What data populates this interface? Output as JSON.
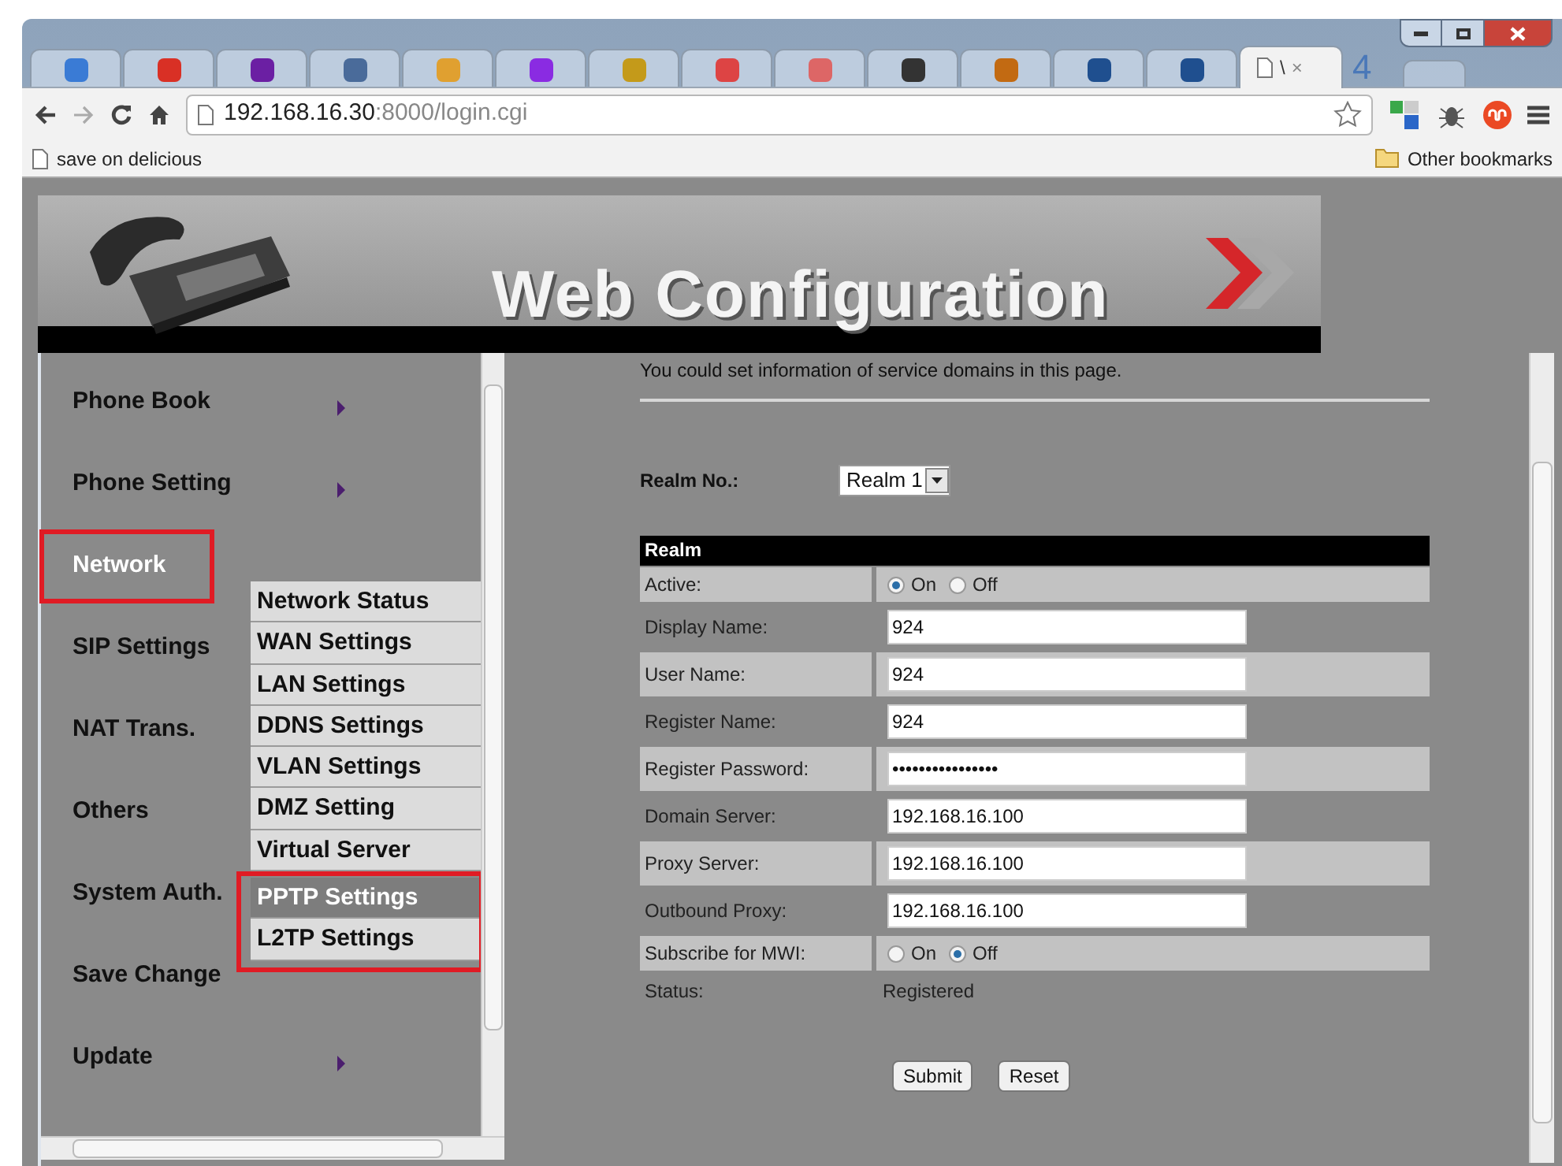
{
  "browser": {
    "tabs": [
      {
        "selected": false
      },
      {
        "selected": false
      },
      {
        "selected": false
      },
      {
        "selected": false
      },
      {
        "selected": false
      },
      {
        "selected": false
      },
      {
        "selected": false
      },
      {
        "selected": false
      },
      {
        "selected": false
      },
      {
        "selected": false
      },
      {
        "selected": false
      },
      {
        "selected": false
      },
      {
        "selected": false
      },
      {
        "selected": true,
        "title": "\\",
        "close": "×"
      }
    ],
    "overflow_label": "4",
    "address": {
      "host": "192.168.16.30",
      "rest": ":8000/login.cgi"
    },
    "bookmarks": [
      {
        "label": "save on delicious"
      }
    ],
    "other_bookmarks": "Other bookmarks"
  },
  "banner": {
    "title": "Web Configuration"
  },
  "menu": {
    "items": [
      {
        "label": "Phone Book",
        "has_submenu": true,
        "selected": false,
        "outlined": false
      },
      {
        "label": "Phone Setting",
        "has_submenu": true,
        "selected": false,
        "outlined": false
      },
      {
        "label": "Network",
        "has_submenu": false,
        "selected": true,
        "outlined": true
      },
      {
        "label": "SIP Settings",
        "has_submenu": false,
        "selected": false,
        "outlined": false
      },
      {
        "label": "NAT Trans.",
        "has_submenu": false,
        "selected": false,
        "outlined": false
      },
      {
        "label": "Others",
        "has_submenu": false,
        "selected": false,
        "outlined": false
      },
      {
        "label": "System Auth.",
        "has_submenu": false,
        "selected": false,
        "outlined": false
      },
      {
        "label": "Save Change",
        "has_submenu": false,
        "selected": false,
        "outlined": false
      },
      {
        "label": "Update",
        "has_submenu": true,
        "selected": false,
        "outlined": false
      }
    ],
    "submenu": [
      {
        "label": "Network Status",
        "selected": false,
        "outlined": false
      },
      {
        "label": "WAN Settings",
        "selected": false,
        "outlined": false
      },
      {
        "label": "LAN Settings",
        "selected": false,
        "outlined": false
      },
      {
        "label": "DDNS Settings",
        "selected": false,
        "outlined": false
      },
      {
        "label": "VLAN Settings",
        "selected": false,
        "outlined": false
      },
      {
        "label": "DMZ Setting",
        "selected": false,
        "outlined": false
      },
      {
        "label": "Virtual Server",
        "selected": false,
        "outlined": false
      },
      {
        "label": "PPTP Settings",
        "selected": true,
        "outlined": true
      },
      {
        "label": "L2TP Settings",
        "selected": false,
        "outlined": true
      }
    ]
  },
  "page": {
    "intro": "You could set information of service domains in this page.",
    "realm_no": {
      "label": "Realm No.:",
      "value": "Realm 1"
    },
    "section": "Realm",
    "rows": [
      {
        "kind": "radio",
        "label": "Active:",
        "options": [
          {
            "label": "On",
            "selected": true
          },
          {
            "label": "Off",
            "selected": false
          }
        ]
      },
      {
        "kind": "field",
        "label": "Display Name:",
        "value": "924"
      },
      {
        "kind": "field",
        "label": "User Name:",
        "value": "924"
      },
      {
        "kind": "field",
        "label": "Register Name:",
        "value": "924"
      },
      {
        "kind": "field",
        "label": "Register Password:",
        "value": "••••••••••••••••"
      },
      {
        "kind": "field",
        "label": "Domain Server:",
        "value": "192.168.16.100"
      },
      {
        "kind": "field",
        "label": "Proxy Server:",
        "value": "192.168.16.100"
      },
      {
        "kind": "field",
        "label": "Outbound Proxy:",
        "value": "192.168.16.100"
      },
      {
        "kind": "radio",
        "label": "Subscribe for MWI:",
        "options": [
          {
            "label": "On",
            "selected": false
          },
          {
            "label": "Off",
            "selected": true
          }
        ]
      },
      {
        "kind": "static",
        "label": "Status:",
        "value": "Registered"
      }
    ],
    "buttons": [
      "Submit",
      "Reset"
    ]
  }
}
